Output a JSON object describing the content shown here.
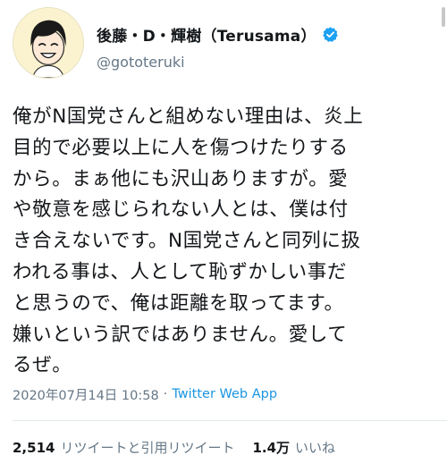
{
  "user": {
    "display_name": "後藤・D・輝樹（Terusama）",
    "handle": "@gototeruki",
    "avatar_icon": "avatar-illustration",
    "verified_icon": "verified-badge-icon"
  },
  "tweet": {
    "text": "俺がN国党さんと組めない理由は、炎上\n目的で必要以上に人を傷つけたりする\nから。まぁ他にも沢山ありますが。愛\nや敬意を感じられない人とは、僕は付\nき合えないです。N国党さんと同列に扱\nわれる事は、人として恥ずかしい事だ\nと思うので、俺は距離を取ってます。\n嫌いという訳ではありません。愛して\nるぜ。"
  },
  "meta": {
    "timestamp": "2020年07月14日 10:58",
    "separator": "·",
    "source": "Twitter Web App"
  },
  "stats": {
    "retweets_count": "2,514",
    "retweets_label": "リツイートと引用リツイート",
    "likes_count": "1.4万",
    "likes_label": "いいね"
  },
  "colors": {
    "link": "#1b95e0",
    "secondary_text": "#657786",
    "verified": "#1da1f2"
  }
}
